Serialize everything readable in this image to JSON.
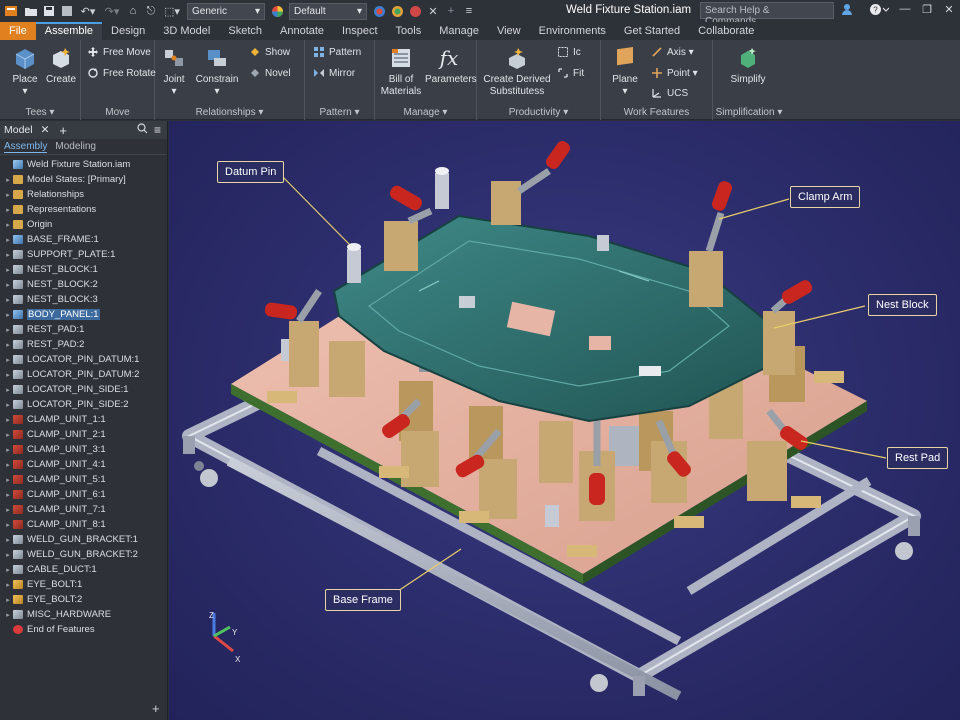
{
  "titlebar": {
    "doc_title": "Weld Fixture Station.iam",
    "appearance_select": "Generic",
    "material_select": "Default",
    "search_placeholder": "Search Help & Commands..."
  },
  "tabs": [
    "File",
    "Assemble",
    "Design",
    "3D Model",
    "Sketch",
    "Annotate",
    "Inspect",
    "Tools",
    "Manage",
    "View",
    "Environments",
    "Get Started",
    "Collaborate"
  ],
  "ribbon": {
    "place": "Place",
    "create": "Create",
    "free_move": "Free Move",
    "free_rotate": "Free Rotate",
    "joint": "Joint",
    "constrain": "Constrain",
    "show": "Show",
    "novel": "Novel",
    "pattern": "Pattern",
    "mirror": "Mirror",
    "bom_line1": "Bill of",
    "bom_line2": "Materials",
    "parameters": "Parameters",
    "create_derived_line1": "Create Derived",
    "create_derived_line2": "Substitutess",
    "fx_glyph": "fx",
    "prod_small1": "Ic",
    "prod_small2": "Fit",
    "plane": "Plane",
    "axis": "Axis",
    "point": "Point",
    "ucs": "UCS",
    "simplify": "Simplify",
    "groups": {
      "tees": "Tees",
      "move": "Move",
      "relationships": "Relationships",
      "pattern": "Pattern",
      "manage": "Manage",
      "productivity": "Productivity",
      "work_features": "Work Features",
      "simplification": "Simplification"
    }
  },
  "browser": {
    "title": "Model",
    "subtabs": [
      "Assembly",
      "Modeling"
    ],
    "tree": [
      {
        "label": "Weld Fixture Station.iam",
        "icon": "doc",
        "arrow": ""
      },
      {
        "label": "Model States: [Primary]",
        "icon": "folder",
        "arrow": "+"
      },
      {
        "label": "Relationships",
        "icon": "folder",
        "arrow": "+"
      },
      {
        "label": "Representations",
        "icon": "folder",
        "arrow": "+"
      },
      {
        "label": "Origin",
        "icon": "folder",
        "arrow": "+"
      },
      {
        "label": "BASE_FRAME:1",
        "icon": "sub",
        "arrow": "+"
      },
      {
        "label": "SUPPORT_PLATE:1",
        "icon": "part",
        "arrow": "+"
      },
      {
        "label": "NEST_BLOCK:1",
        "icon": "part",
        "arrow": "+"
      },
      {
        "label": "NEST_BLOCK:2",
        "icon": "part",
        "arrow": "+"
      },
      {
        "label": "NEST_BLOCK:3",
        "icon": "part",
        "arrow": "+"
      },
      {
        "label": "BODY_PANEL:1",
        "icon": "sub",
        "arrow": "+",
        "selected": true
      },
      {
        "label": "REST_PAD:1",
        "icon": "part",
        "arrow": "+"
      },
      {
        "label": "REST_PAD:2",
        "icon": "part",
        "arrow": "+"
      },
      {
        "label": "LOCATOR_PIN_DATUM:1",
        "icon": "part",
        "arrow": "+"
      },
      {
        "label": "LOCATOR_PIN_DATUM:2",
        "icon": "part",
        "arrow": "+"
      },
      {
        "label": "LOCATOR_PIN_SIDE:1",
        "icon": "part",
        "arrow": "+"
      },
      {
        "label": "LOCATOR_PIN_SIDE:2",
        "icon": "part",
        "arrow": "+"
      },
      {
        "label": "CLAMP_UNIT_1:1",
        "icon": "clamp",
        "arrow": "+"
      },
      {
        "label": "CLAMP_UNIT_2:1",
        "icon": "clamp",
        "arrow": "+"
      },
      {
        "label": "CLAMP_UNIT_3:1",
        "icon": "clamp",
        "arrow": "+"
      },
      {
        "label": "CLAMP_UNIT_4:1",
        "icon": "clamp",
        "arrow": "+"
      },
      {
        "label": "CLAMP_UNIT_5:1",
        "icon": "clamp",
        "arrow": "+"
      },
      {
        "label": "CLAMP_UNIT_6:1",
        "icon": "clamp",
        "arrow": "+"
      },
      {
        "label": "CLAMP_UNIT_7:1",
        "icon": "clamp",
        "arrow": "+"
      },
      {
        "label": "CLAMP_UNIT_8:1",
        "icon": "clamp",
        "arrow": "+"
      },
      {
        "label": "WELD_GUN_BRACKET:1",
        "icon": "part",
        "arrow": "+"
      },
      {
        "label": "WELD_GUN_BRACKET:2",
        "icon": "part",
        "arrow": "+"
      },
      {
        "label": "CABLE_DUCT:1",
        "icon": "part",
        "arrow": "+"
      },
      {
        "label": "EYE_BOLT:1",
        "icon": "asm",
        "arrow": "+"
      },
      {
        "label": "EYE_BOLT:2",
        "icon": "asm",
        "arrow": "+"
      },
      {
        "label": "MISC_HARDWARE",
        "icon": "part",
        "arrow": "+"
      },
      {
        "label": "End of Features",
        "icon": "end",
        "arrow": ""
      }
    ]
  },
  "callouts": {
    "datum_pin": "Datum Pin",
    "clamp_arm": "Clamp Arm",
    "nest_block": "Nest Block",
    "rest_pad": "Rest Pad",
    "base_frame": "Base Frame"
  },
  "triad": {
    "x": "X",
    "y": "Y",
    "z": "Z"
  },
  "colors": {
    "accent": "#e0801f",
    "tab_highlight": "#4c9ee3",
    "viewport_bg": "#2b2c6a",
    "panel_teal": "#2f6e6e",
    "plate_pink": "#e6b5a6",
    "clamp_handle": "#c8261e"
  }
}
